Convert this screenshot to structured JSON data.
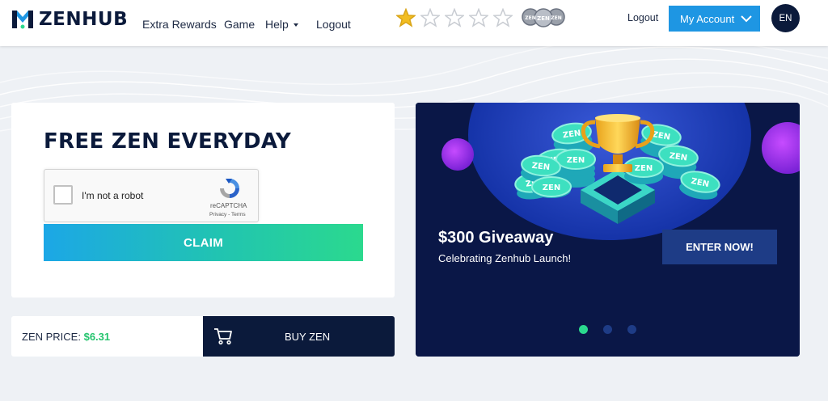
{
  "header": {
    "brand": "ZENHUB",
    "nav": [
      {
        "label": "Extra Rewards"
      },
      {
        "label": "Game"
      },
      {
        "label": "Help"
      },
      {
        "label": "Logout"
      }
    ],
    "rating": {
      "value": 1,
      "max": 5
    },
    "coin_badge_text": "ZEN",
    "logout_label": "Logout",
    "account_label": "My Account",
    "language": "EN"
  },
  "claim": {
    "title": "FREE ZEN EVERYDAY",
    "captcha_label": "I'm not a robot",
    "captcha_brand": "reCAPTCHA",
    "captcha_terms": "Privacy - Terms",
    "claim_label": "CLAIM"
  },
  "price": {
    "label": "ZEN PRICE:",
    "value": "$6.31",
    "buy_label": "BUY ZEN"
  },
  "promo": {
    "title": "$300 Giveaway",
    "subtitle": "Celebrating Zenhub Launch!",
    "cta": "ENTER NOW!",
    "coin_text": "ZEN",
    "slides": 3,
    "active_slide": 1
  },
  "colors": {
    "brand_navy": "#0b1a3b",
    "accent_blue": "#1e96e3",
    "accent_green": "#2bd98e",
    "star_gold": "#f2bd21"
  }
}
